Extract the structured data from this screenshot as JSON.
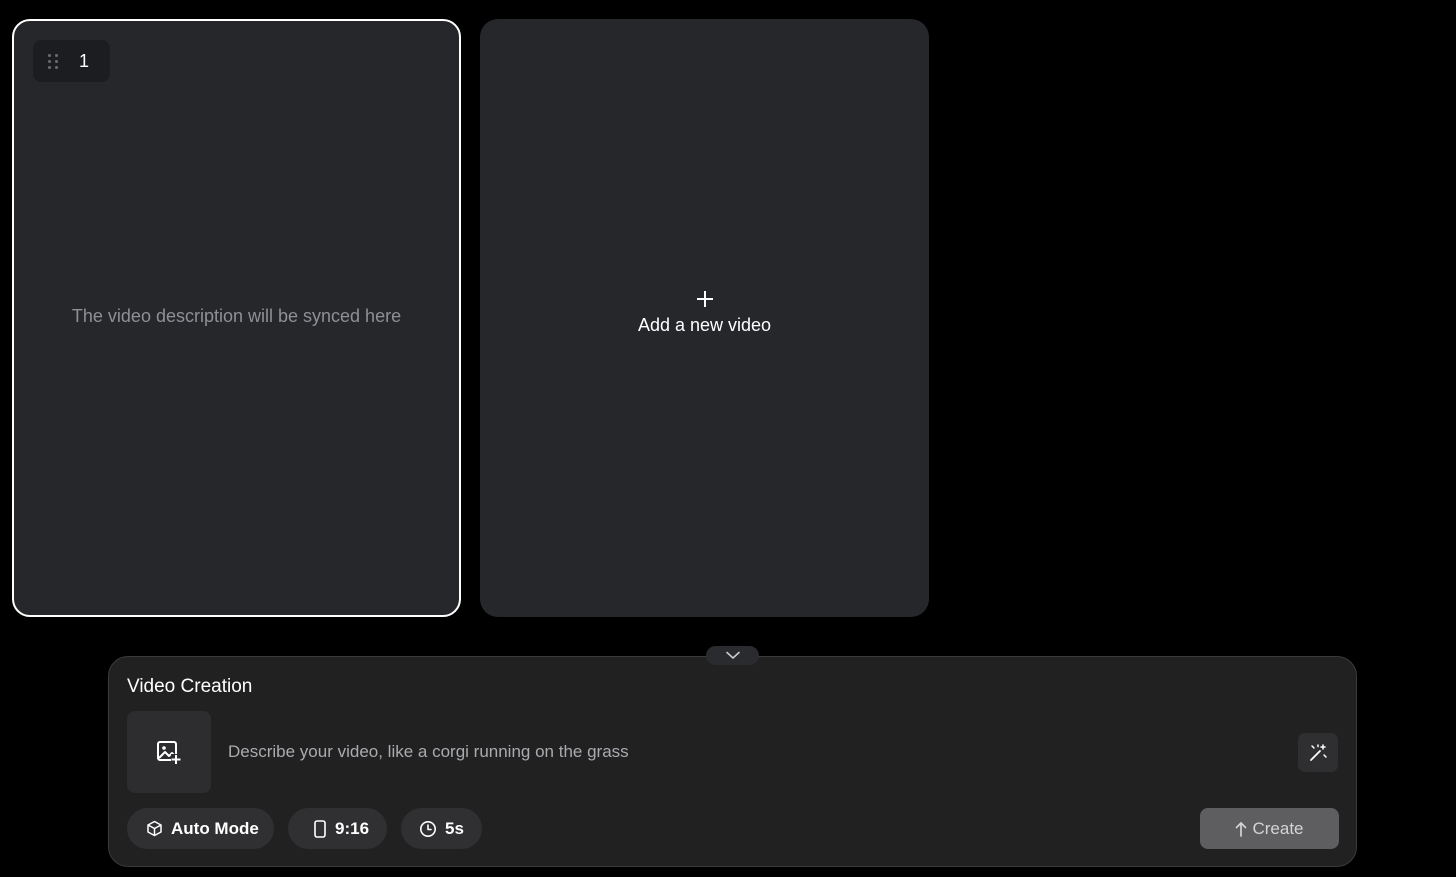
{
  "cards": [
    {
      "index": "1",
      "placeholder": "The video description will be synced here"
    }
  ],
  "add_card": {
    "label": "Add a new video",
    "icon": "plus-icon"
  },
  "panel": {
    "title": "Video Creation",
    "prompt_placeholder": "Describe your video, like a corgi running on the grass",
    "upload_icon": "image-add-icon",
    "magic_icon": "magic-wand-icon",
    "collapse_icon": "chevron-down-icon",
    "options": {
      "mode": {
        "label": "Auto Mode",
        "icon": "cube-icon"
      },
      "ratio": {
        "label": "9:16",
        "icon": "phone-icon"
      },
      "duration": {
        "label": "5s",
        "icon": "clock-icon"
      }
    },
    "create_label": "Create",
    "create_icon": "arrow-up-icon"
  },
  "colors": {
    "background": "#000000",
    "card": "#26272b",
    "panel": "#212122",
    "create_button": "#5e5e60"
  }
}
